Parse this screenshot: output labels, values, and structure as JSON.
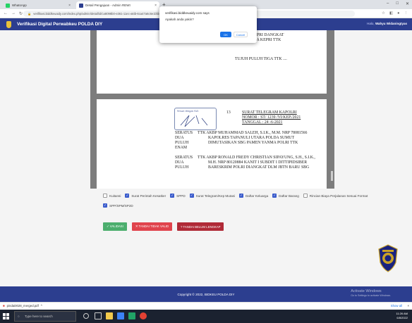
{
  "browser": {
    "tabs": [
      {
        "label": "WhatsApp",
        "fav_color": "#25d366"
      },
      {
        "label": "Detail Pengajuan - Admin REWI",
        "fav_color": "#2c3e8f"
      }
    ],
    "new_tab": "+",
    "url": "verifikasi.biddkeuaidy.com/index.php/admin/detail/id/ca8098b0-e361-11ec-a6ib-6ca47a6c6e1bfdetail/1",
    "window_controls": [
      "–",
      "□",
      "✕"
    ]
  },
  "app": {
    "title": "Verifikasi Digital Perwabkeu POLDA DIY",
    "user_greeting": "Halo,",
    "user_name": "Wahyu Widaningtyas"
  },
  "document": {
    "page1": {
      "line1": "DIRPOLAIRUD POLDA KEPRI DANGKAT",
      "line2": "SBG DIRPOLAIRUD POLDA KEPRI TTK",
      "line3": "TUJUH PULUH TIGA TTK ...."
    },
    "page2": {
      "stamp": "Sesuai dengan Asli",
      "num": "13",
      "ref1": "SURAT TELEGRAM KAPOLRI",
      "ref2": "NOMOR : ST/ 1239 /VI/KEP./2021",
      "ref3": "TANGGAL : 24 -6-2021",
      "p1_left": [
        "SERATUS",
        "DUA",
        "PULUH",
        "ENAM"
      ],
      "p1_text": [
        "TTK AKBP MUHAMMAD SALEH, S.I.K., M.M. NRP 78081566",
        "KAPOLRES TAPANULI UTARA POLDA SUMUT",
        "DIMUTASIKAN SBG PAMEN YANMA POLRI TTK"
      ],
      "p2_left": [
        "SERATUS",
        "DUA",
        "PULUH"
      ],
      "p2_text": [
        "TTK AKBP RONALD FREDY CHRISTIAN SIPAYUNG, S.H., S.I.K.,",
        "M.H. NRP 80120884 KANIT I SUBDIT I DITTIPIDSIBER",
        "BARESKRIM POLRI DIANGKAT DLM JBTN BARU SBG"
      ]
    }
  },
  "dialog": {
    "origin": "verifikasi.biddkeuaidy.com says",
    "message": "Apakah anda yakin?",
    "ok": "OK",
    "cancel": "Cancel"
  },
  "checklist": {
    "items": [
      {
        "label": "Kuitansi",
        "checked": false
      },
      {
        "label": "Surat Perintah Kesatker",
        "checked": true
      },
      {
        "label": "SPPD",
        "checked": true
      },
      {
        "label": "Surat Telegram/Kep Mutasi",
        "checked": true
      },
      {
        "label": "Daftar Keluarga",
        "checked": true
      },
      {
        "label": "Daftar Barang",
        "checked": true
      },
      {
        "label": "Rincian Biaya Perjalanan Sesuai Format",
        "checked": false
      },
      {
        "label": "SPP/SPM/SP2D",
        "checked": true
      }
    ]
  },
  "actions": {
    "validasi": "✓ VALIDASI",
    "tidak_valid": "✕ TANDAI TIDAK VALID",
    "belum_lengkap": "? TANDAI BELUM LENGKAP"
  },
  "footer": {
    "copyright": "Copyright © 2022, BIDKEU POLDA DIY",
    "activate_title": "Activate Windows",
    "activate_sub": "Go to Settings to activate Windows."
  },
  "downloads": {
    "file": "pindai0028_merged.pdf",
    "show_all": "Show all"
  },
  "taskbar": {
    "search": "Type here to search",
    "time": "11:26 AM",
    "date": "6/8/2022"
  },
  "colors": {
    "header": "#2c3e8f",
    "checkbox": "#3b5ccc",
    "validate": "#4cae6e",
    "invalid": "#e0434c",
    "incomplete": "#b02a37"
  }
}
